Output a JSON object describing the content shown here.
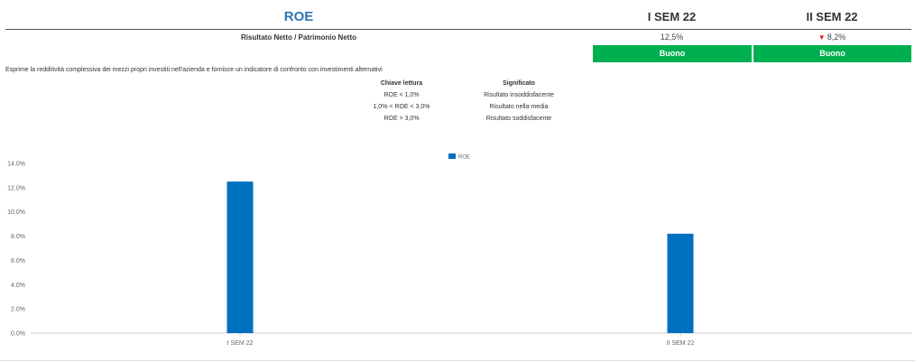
{
  "header": {
    "title": "ROE",
    "periods": [
      "I SEM 22",
      "II SEM 22"
    ]
  },
  "formula": "Risultato Netto / Patrimonio Netto",
  "values": [
    {
      "text": "12,5%",
      "trend": ""
    },
    {
      "text": "8,2%",
      "trend": "down"
    }
  ],
  "ratings": [
    "Buono",
    "Buono"
  ],
  "colors": {
    "accent": "#2e75b6",
    "good": "#00b050",
    "bar": "#0070c0",
    "trend_down": "#e02020"
  },
  "description": "Esprime la redditività complessiva dei mezzi propri investiti nell'azienda e fornisce un indicatore di confronto con investimenti alternativi",
  "reading_key": {
    "col1_header": "Chiave lettura",
    "col2_header": "Significato",
    "rows": [
      {
        "key": "ROE < 1,0%",
        "meaning": "Risultato insoddisfacente"
      },
      {
        "key": "1,0% < ROE < 3,0%",
        "meaning": "Risultato nella media"
      },
      {
        "key": "ROE > 3,0%",
        "meaning": "Risultato soddisfacente"
      }
    ]
  },
  "chart_data": {
    "type": "bar",
    "categories": [
      "I SEM 22",
      "II SEM 22"
    ],
    "series": [
      {
        "name": "ROE",
        "values": [
          12.5,
          8.2
        ]
      }
    ],
    "ylim": [
      0,
      14
    ],
    "yticks": [
      0,
      2,
      4,
      6,
      8,
      10,
      12,
      14
    ],
    "ytick_labels": [
      "0.0%",
      "2.0%",
      "4.0%",
      "6.0%",
      "8.0%",
      "10.0%",
      "12.0%",
      "14.0%"
    ],
    "legend": "top-center",
    "grid": false
  }
}
